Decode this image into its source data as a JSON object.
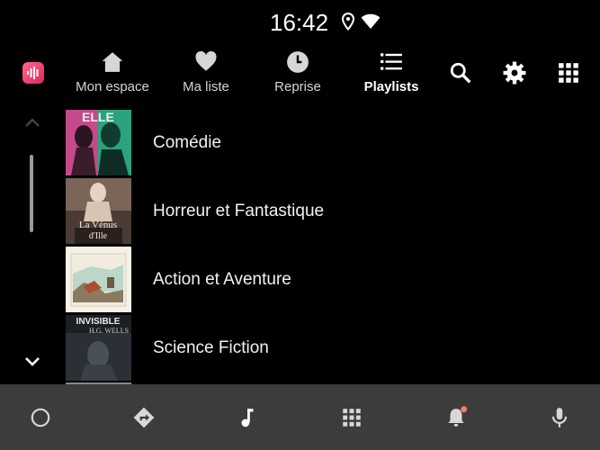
{
  "status": {
    "time": "16:42",
    "icons": [
      "location-icon",
      "wifi-icon"
    ]
  },
  "app": {
    "logo_icon": "audio-wave-icon",
    "accent": "#e0245e"
  },
  "tabs": [
    {
      "label": "Mon espace",
      "icon": "home-icon",
      "active": false
    },
    {
      "label": "Ma liste",
      "icon": "heart-icon",
      "active": false
    },
    {
      "label": "Reprise",
      "icon": "clock-icon",
      "active": false
    },
    {
      "label": "Playlists",
      "icon": "list-icon",
      "active": true
    }
  ],
  "top_actions": [
    "search-icon",
    "gear-icon",
    "apps-grid-icon"
  ],
  "playlists": [
    {
      "title": "Comédie"
    },
    {
      "title": "Horreur et Fantastique",
      "cover_text": [
        "La Vénus",
        "d'Ille"
      ]
    },
    {
      "title": "Action et Aventure"
    },
    {
      "title": "Science Fiction",
      "cover_text": [
        "INVISIBLE",
        "H.G. WELLS"
      ]
    }
  ],
  "cover_text_comedy": "ELLE",
  "bottom_bar": {
    "buttons": [
      "home-circle-icon",
      "navigation-icon",
      "music-note-icon",
      "apps-grid-icon",
      "notification-bell-icon",
      "microphone-icon"
    ],
    "notification_dot_color": "#ff7b6b"
  }
}
